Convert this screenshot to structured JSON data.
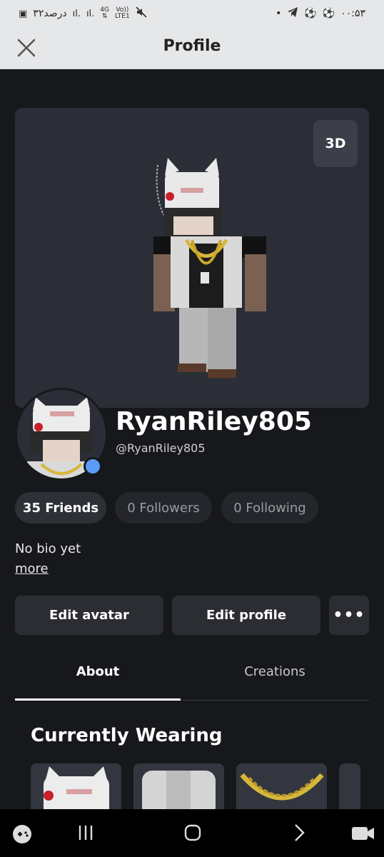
{
  "status_bar": {
    "left_text": "۳۲درصد",
    "network": "4G",
    "volte": "Vo))",
    "volte_sub": "LTE1",
    "time": "۰۰:۵۳"
  },
  "header": {
    "title": "Profile"
  },
  "showcase": {
    "view_toggle": "3D"
  },
  "profile": {
    "display_name": "RyanRiley805",
    "username": "@RyanRiley805",
    "friends": "35 Friends",
    "followers": "0 Followers",
    "following": "0 Following",
    "bio": "No bio yet",
    "more_link": "more"
  },
  "actions": {
    "edit_avatar": "Edit avatar",
    "edit_profile": "Edit profile",
    "more": "•••"
  },
  "tabs": [
    {
      "label": "About",
      "active": true
    },
    {
      "label": "Creations",
      "active": false
    }
  ],
  "wearing": {
    "title": "Currently Wearing"
  },
  "icons": {
    "close": "close-icon",
    "more": "more-icon",
    "nav": [
      "game-controller-icon",
      "recents-icon",
      "home-icon",
      "back-icon",
      "camera-icon"
    ]
  },
  "colors": {
    "online": "#5a9cf7",
    "background": "#17181b",
    "card": "#2b2e37"
  }
}
